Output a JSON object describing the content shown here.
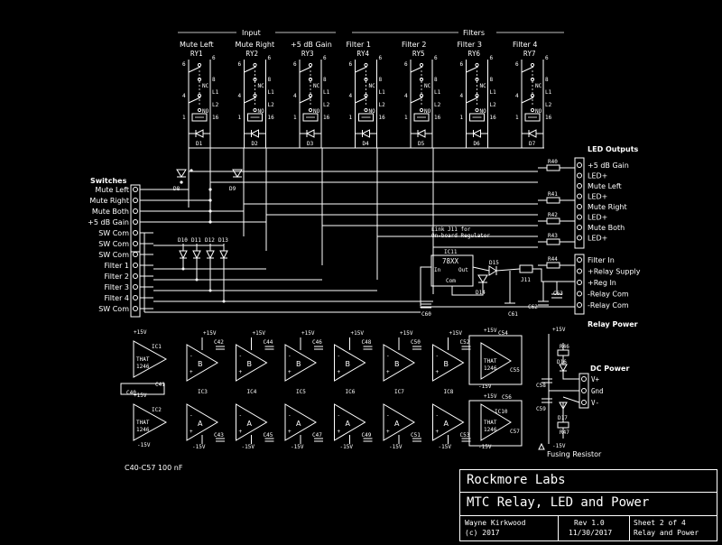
{
  "groups": {
    "input": "Input",
    "filters": "Filters"
  },
  "relays": [
    {
      "name": "Mute Left",
      "ref": "RY1",
      "diode": "D1"
    },
    {
      "name": "Mute Right",
      "ref": "RY2",
      "diode": "D2"
    },
    {
      "name": "+5 dB Gain",
      "ref": "RY3",
      "diode": "D3"
    },
    {
      "name": "Filter 1",
      "ref": "RY4",
      "diode": "D4"
    },
    {
      "name": "Filter 2",
      "ref": "RY5",
      "diode": "D5"
    },
    {
      "name": "Filter 3",
      "ref": "RY6",
      "diode": "D6"
    },
    {
      "name": "Filter 4",
      "ref": "RY7",
      "diode": "D7"
    }
  ],
  "relay_pins": [
    "6",
    "8",
    "NC",
    "4",
    "NO",
    "L1",
    "L2",
    "6",
    "1",
    "16"
  ],
  "switches": {
    "title": "Switches",
    "pins": [
      "Mute Left",
      "Mute Right",
      "Mute Both",
      "+5 dB Gain",
      "SW Com",
      "SW Com",
      "SW Com",
      "Filter 1",
      "Filter 2",
      "Filter 3",
      "Filter 4",
      "SW Com"
    ]
  },
  "steer_diodes": [
    "D8",
    "D9"
  ],
  "diode_array": [
    "D10",
    "D11",
    "D12",
    "D13"
  ],
  "led_outputs": {
    "title": "LED Outputs",
    "pins": [
      "+5 dB Gain",
      "LED+",
      "Mute Left",
      "LED+",
      "Mute Right",
      "LED+",
      "Mute Both",
      "LED+"
    ],
    "resistors": [
      "R40",
      "R41",
      "R42",
      "R43",
      "R44"
    ]
  },
  "relay_power": {
    "title": "Relay Power",
    "pins": [
      "Filter In",
      "+Relay Supply",
      "+Reg In",
      "-Relay Com",
      "-Relay Com"
    ]
  },
  "regulator": {
    "ref": "IC11",
    "part": "78XX",
    "in": "In",
    "out": "Out",
    "com": "Com",
    "note_line1": "Link J11 for",
    "note_line2": "On-board Regulator",
    "jumper": "J11",
    "diodes": [
      "D14",
      "D15"
    ],
    "caps": [
      "C60",
      "C61",
      "C62",
      "C63"
    ]
  },
  "opamps": {
    "top": [
      {
        "ref": "IC1",
        "ch": "B",
        "cap": "C42"
      },
      {
        "ref": "IC3",
        "ch": "B",
        "cap": "C42"
      },
      {
        "ref": "IC4",
        "ch": "B",
        "cap": "C44"
      },
      {
        "ref": "IC5",
        "ch": "B",
        "cap": "C46"
      },
      {
        "ref": "IC6",
        "ch": "B",
        "cap": "C48"
      },
      {
        "ref": "IC7",
        "ch": "B",
        "cap": "C50"
      },
      {
        "ref": "IC8",
        "ch": "B",
        "cap": "C52"
      }
    ],
    "bottom_caps": [
      "C43",
      "C45",
      "C47",
      "C49",
      "C51",
      "C53"
    ],
    "that": [
      "THAT",
      "1246"
    ],
    "ic2": "IC2",
    "c40": "C40",
    "c41": "C41",
    "ic9_caps": [
      "C54",
      "C55"
    ],
    "ic10": "IC10",
    "ic10_caps": [
      "C56",
      "C57"
    ],
    "pos": "+15V",
    "neg": "-15V",
    "plus": "+",
    "minus": "-",
    "ch_a": "A",
    "ch_b": "B",
    "cap_note": "C40-C57 100 nF"
  },
  "dc_power": {
    "title": "DC Power",
    "pins": [
      "V+",
      "Gnd",
      "V-"
    ],
    "pos": "+15V",
    "neg": "-15V",
    "parts": [
      "R46",
      "R47",
      "D16",
      "D17",
      "C58",
      "C59"
    ],
    "fuse_note": "Fusing Resistor"
  },
  "title_block": {
    "company": "Rockmore Labs",
    "title": "MTC Relay, LED and Power",
    "author": "Wayne Kirkwood",
    "copyright": "(c) 2017",
    "rev": "Rev 1.0",
    "date": "11/30/2017",
    "sheet": "Sheet 2 of 4",
    "sheet_name": "Relay and Power"
  }
}
